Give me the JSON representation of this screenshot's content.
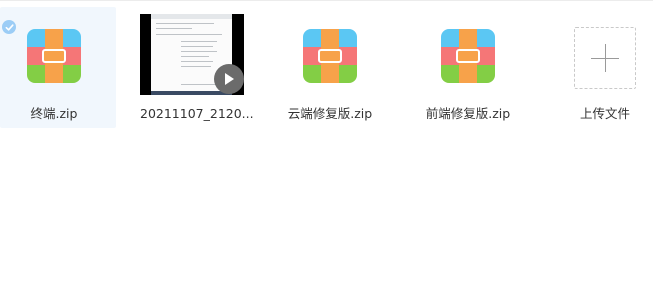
{
  "files": [
    {
      "name": "终端.zip",
      "type": "zip",
      "selected": true
    },
    {
      "name": "20211107_2120...",
      "type": "video",
      "selected": false
    },
    {
      "name": "云端修复版.zip",
      "type": "zip",
      "selected": false
    },
    {
      "name": "前端修复版.zip",
      "type": "zip",
      "selected": false
    }
  ],
  "upload": {
    "label": "上传文件",
    "icon": "plus-icon"
  },
  "icons": {
    "zip": "zip-archive-icon",
    "video": "play-icon",
    "selected": "check-icon"
  },
  "colors": {
    "selected_bg": "#f1f7fd",
    "check": "#9ccdf6",
    "zip_blue": "#5bc7f3",
    "zip_red": "#f57677",
    "zip_green": "#83ce45",
    "zip_strap": "#f7a24a"
  }
}
